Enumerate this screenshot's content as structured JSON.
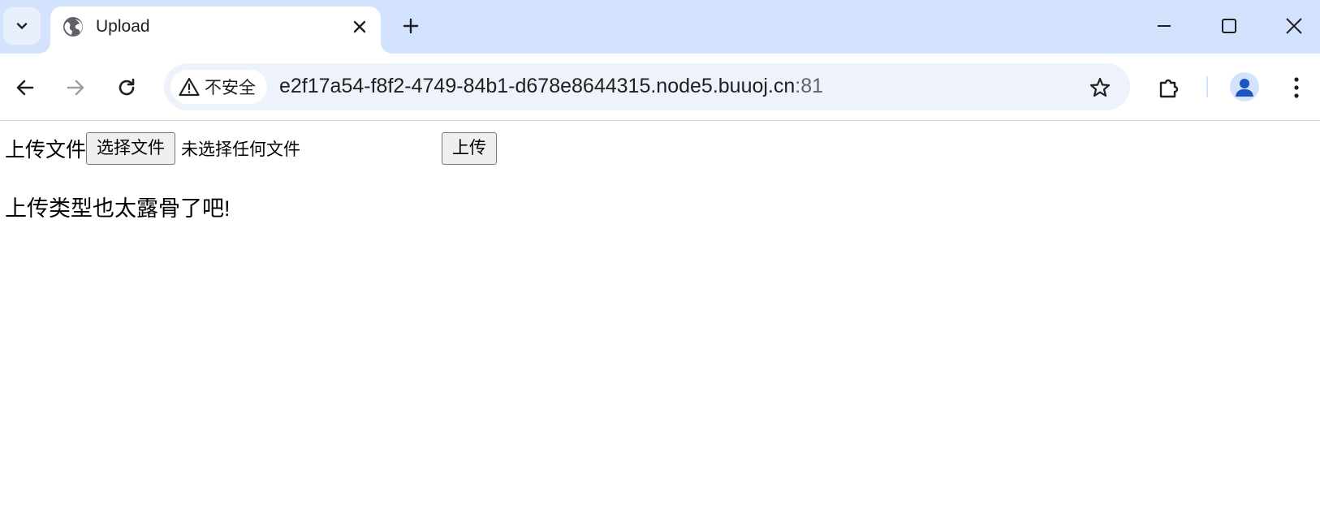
{
  "browser": {
    "tab": {
      "title": "Upload",
      "favicon_icon": "globe-icon",
      "close_icon": "close-icon"
    },
    "tab_menu_icon": "chevron-down-icon",
    "new_tab_icon": "plus-icon",
    "window_controls": [
      "minimize-icon",
      "maximize-icon",
      "close-icon"
    ],
    "nav": {
      "back_icon": "arrow-left-icon",
      "forward_icon": "arrow-right-icon",
      "reload_icon": "reload-icon"
    },
    "omnibox": {
      "security_label": "不安全",
      "security_icon": "warning-icon",
      "url_host": "e2f17a54-f8f2-4749-84b1-d678e8644315.node5.buuoj.cn",
      "url_port": ":81",
      "bookmark_icon": "star-icon"
    },
    "extensions_icon": "puzzle-icon",
    "profile_icon": "person-icon",
    "menu_icon": "more-vert-icon"
  },
  "page": {
    "upload_label": "上传文件",
    "choose_file_button": "选择文件",
    "no_file_text": "未选择任何文件",
    "submit_button": "上传",
    "message": "上传类型也太露骨了吧!"
  }
}
